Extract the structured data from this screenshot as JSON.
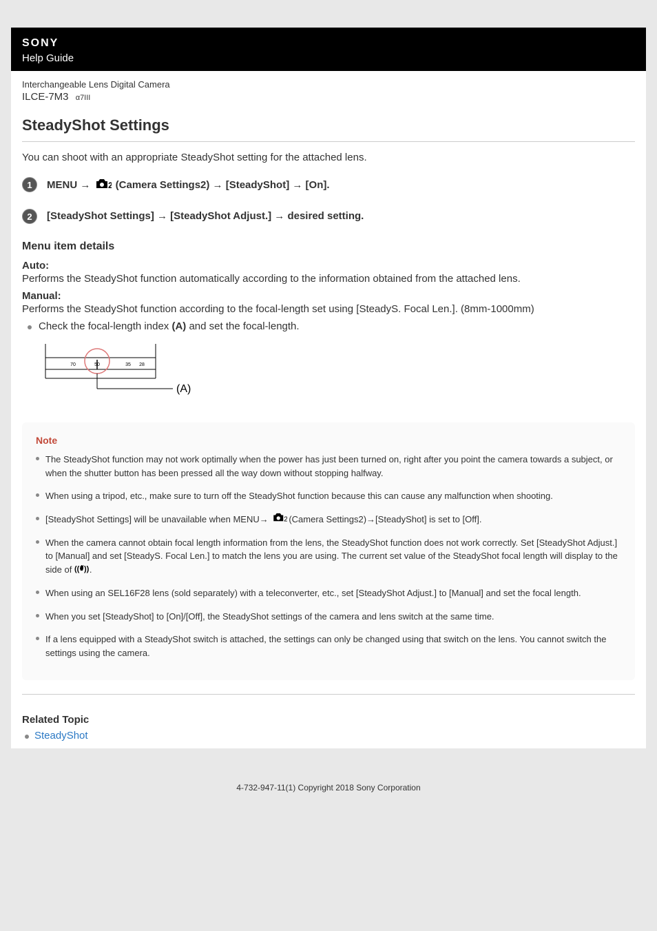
{
  "header": {
    "brand": "SONY",
    "guide": "Help Guide"
  },
  "product": {
    "type": "Interchangeable Lens Digital Camera",
    "model": "ILCE-7M3",
    "model_sub": "α7III"
  },
  "title": "SteadyShot Settings",
  "intro": "You can shoot with an appropriate SteadyShot setting for the attached lens.",
  "steps": {
    "s1": {
      "num": "1",
      "pre": "MENU → ",
      "post": " (Camera Settings2) → [SteadyShot] → [On]."
    },
    "s2": {
      "num": "2",
      "text": "[SteadyShot Settings] → [SteadyShot Adjust.] → desired setting."
    }
  },
  "menu_details": {
    "heading": "Menu item details",
    "auto": {
      "label": "Auto:",
      "desc": "Performs the SteadyShot function automatically according to the information obtained from the attached lens."
    },
    "manual": {
      "label": "Manual:",
      "desc": "Performs the SteadyShot function according to the focal-length set using [SteadyS. Focal Len.]. (8mm-1000mm)",
      "bullet_pre": "Check the focal-length index ",
      "bullet_bold": "(A)",
      "bullet_post": " and set the focal-length."
    }
  },
  "illustration": {
    "marks": {
      "a": "70",
      "c": "35",
      "d": "28"
    },
    "label": "(A)"
  },
  "note": {
    "title": "Note",
    "title_color": "#c24a3a",
    "items": {
      "n1": "The SteadyShot function may not work optimally when the power has just been turned on, right after you point the camera towards a subject, or when the shutter button has been pressed all the way down without stopping halfway.",
      "n2": "When using a tripod, etc., make sure to turn off the SteadyShot function because this can cause any malfunction when shooting.",
      "n3_pre": "[SteadyShot Settings] will be unavailable when MENU→ ",
      "n3_post": "(Camera Settings2)→[SteadyShot] is set to [Off].",
      "n4_pre": "When the camera cannot obtain focal length information from the lens, the SteadyShot function does not work correctly. Set [SteadyShot Adjust.] to [Manual] and set [SteadyS. Focal Len.] to match the lens you are using. The current set value of the SteadyShot focal length will display to the side of ",
      "n4_post": ".",
      "n5": "When using an SEL16F28 lens (sold separately) with a teleconverter, etc., set [SteadyShot Adjust.] to [Manual] and set the focal length.",
      "n6": "When you set [SteadyShot] to [On]/[Off], the SteadyShot settings of the camera and lens switch at the same time.",
      "n7": "If a lens equipped with a SteadyShot switch is attached, the settings can only be changed using that switch on the lens. You cannot switch the settings using the camera."
    }
  },
  "related": {
    "heading": "Related Topic",
    "link": "SteadyShot"
  },
  "footer": "4-732-947-11(1) Copyright 2018 Sony Corporation"
}
